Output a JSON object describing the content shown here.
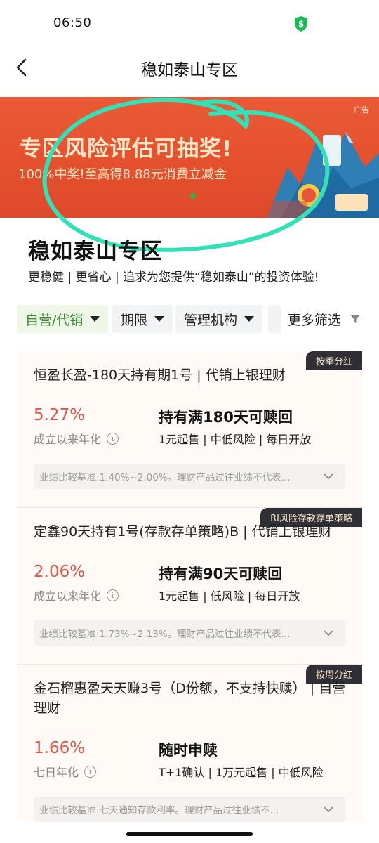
{
  "status_bar": {
    "time": "06:50"
  },
  "nav": {
    "title": "稳如泰山专区"
  },
  "banner": {
    "ad_label": "广告",
    "title": "专区风险评估可抽奖!",
    "subtitle": "100%中奖!至高得8.88元消费立减金",
    "accent_color": "#e4502e"
  },
  "zone": {
    "title": "稳如泰山专区",
    "description": "更稳健 | 更省心 | 追求为您提供“稳如泰山”的投资体验!"
  },
  "filters": {
    "chips": [
      {
        "label": "自营/代销"
      },
      {
        "label": "期限"
      },
      {
        "label": "管理机构"
      }
    ],
    "more_label": "更多筛选"
  },
  "products": [
    {
      "tag": "按季分红",
      "name": "恒盈长盈-180天持有期1号 | 代销上银理财",
      "rate": "5.27%",
      "rate_label": "成立以来年化",
      "headline": "持有满180天可赎回",
      "meta": "1元起售 | 中低风险 | 每日开放",
      "benchmark": "业绩比较基准:1.40%~2.00%。理财产品过往业绩不代表..."
    },
    {
      "tag": "RI风险存款存单策略",
      "name": "定鑫90天持有1号(存款存单策略)B | 代销上银理财",
      "rate": "2.06%",
      "rate_label": "成立以来年化",
      "headline": "持有满90天可赎回",
      "meta": "1元起售 | 低风险 | 每日开放",
      "benchmark": "业绩比较基准:1.73%~2.13%。理财产品过往业绩不代表..."
    },
    {
      "tag": "按周分红",
      "name": "金石榴惠盈天天赚3号（D份额，不支持快赎） | 自营理财",
      "rate": "1.66%",
      "rate_label": "七日年化",
      "headline": "随时申赎",
      "meta": "T+1确认 | 1万元起售 | 中低风险",
      "benchmark": "业绩比较基准:七天通知存款利率。理财产品过往业绩不..."
    }
  ]
}
